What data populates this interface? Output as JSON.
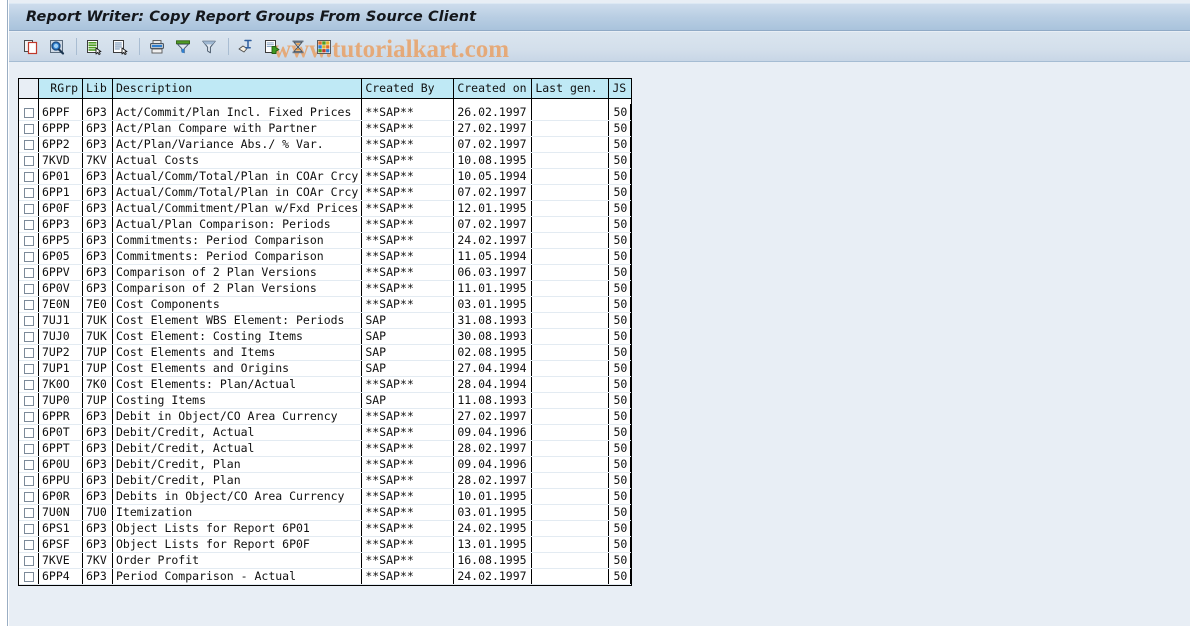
{
  "window": {
    "title": "Report Writer: Copy Report Groups From Source Client",
    "watermark": "www.tutorialkart.com"
  },
  "toolbar": {
    "items": [
      {
        "name": "copy-icon",
        "tooltip": "Copy"
      },
      {
        "name": "display-search-icon",
        "tooltip": "Display"
      },
      {
        "name": "separator",
        "tooltip": ""
      },
      {
        "name": "select-all-icon",
        "tooltip": "Select All"
      },
      {
        "name": "deselect-all-icon",
        "tooltip": "Deselect All"
      },
      {
        "name": "separator",
        "tooltip": ""
      },
      {
        "name": "print-icon",
        "tooltip": "Print"
      },
      {
        "name": "sort-filter-icon",
        "tooltip": "Sort"
      },
      {
        "name": "filter-icon",
        "tooltip": "Filter"
      },
      {
        "name": "separator",
        "tooltip": ""
      },
      {
        "name": "select-layout-icon",
        "tooltip": "Choose Layout"
      },
      {
        "name": "export-icon",
        "tooltip": "Export"
      },
      {
        "name": "hourglass-icon",
        "tooltip": "Wait"
      },
      {
        "name": "spreadsheet-icon",
        "tooltip": "Spreadsheet"
      }
    ]
  },
  "table": {
    "columns": [
      {
        "key": "rgrp",
        "label": "RGrp"
      },
      {
        "key": "lib",
        "label": "Lib"
      },
      {
        "key": "desc",
        "label": "Description"
      },
      {
        "key": "by",
        "label": "Created By"
      },
      {
        "key": "on",
        "label": "Created on"
      },
      {
        "key": "gen",
        "label": "Last gen."
      },
      {
        "key": "js",
        "label": "JS"
      }
    ],
    "rows": [
      {
        "rgrp": "6PPF",
        "lib": "6P3",
        "desc": "Act/Commit/Plan Incl. Fixed Prices",
        "by": "**SAP**",
        "on": "26.02.1997",
        "gen": "",
        "js": "50"
      },
      {
        "rgrp": "6PPP",
        "lib": "6P3",
        "desc": "Act/Plan Compare with Partner",
        "by": "**SAP**",
        "on": "27.02.1997",
        "gen": "",
        "js": "50"
      },
      {
        "rgrp": "6PP2",
        "lib": "6P3",
        "desc": "Act/Plan/Variance Abs./ % Var.",
        "by": "**SAP**",
        "on": "07.02.1997",
        "gen": "",
        "js": "50"
      },
      {
        "rgrp": "7KVD",
        "lib": "7KV",
        "desc": "Actual Costs",
        "by": "**SAP**",
        "on": "10.08.1995",
        "gen": "",
        "js": "50"
      },
      {
        "rgrp": "6P01",
        "lib": "6P3",
        "desc": "Actual/Comm/Total/Plan in COAr Crcy",
        "by": "**SAP**",
        "on": "10.05.1994",
        "gen": "",
        "js": "50"
      },
      {
        "rgrp": "6PP1",
        "lib": "6P3",
        "desc": "Actual/Comm/Total/Plan in COAr Crcy",
        "by": "**SAP**",
        "on": "07.02.1997",
        "gen": "",
        "js": "50"
      },
      {
        "rgrp": "6P0F",
        "lib": "6P3",
        "desc": "Actual/Commitment/Plan w/Fxd Prices",
        "by": "**SAP**",
        "on": "12.01.1995",
        "gen": "",
        "js": "50"
      },
      {
        "rgrp": "6PP3",
        "lib": "6P3",
        "desc": "Actual/Plan Comparison: Periods",
        "by": "**SAP**",
        "on": "07.02.1997",
        "gen": "",
        "js": "50"
      },
      {
        "rgrp": "6PP5",
        "lib": "6P3",
        "desc": "Commitments: Period Comparison",
        "by": "**SAP**",
        "on": "24.02.1997",
        "gen": "",
        "js": "50"
      },
      {
        "rgrp": "6P05",
        "lib": "6P3",
        "desc": "Commitments: Period Comparison",
        "by": "**SAP**",
        "on": "11.05.1994",
        "gen": "",
        "js": "50"
      },
      {
        "rgrp": "6PPV",
        "lib": "6P3",
        "desc": "Comparison of 2 Plan Versions",
        "by": "**SAP**",
        "on": "06.03.1997",
        "gen": "",
        "js": "50"
      },
      {
        "rgrp": "6P0V",
        "lib": "6P3",
        "desc": "Comparison of 2 Plan Versions",
        "by": "**SAP**",
        "on": "11.01.1995",
        "gen": "",
        "js": "50"
      },
      {
        "rgrp": "7E0N",
        "lib": "7E0",
        "desc": "Cost Components",
        "by": "**SAP**",
        "on": "03.01.1995",
        "gen": "",
        "js": "50"
      },
      {
        "rgrp": "7UJ1",
        "lib": "7UK",
        "desc": "Cost Element WBS Element: Periods",
        "by": "SAP",
        "on": "31.08.1993",
        "gen": "",
        "js": "50"
      },
      {
        "rgrp": "7UJ0",
        "lib": "7UK",
        "desc": "Cost Element: Costing Items",
        "by": "SAP",
        "on": "30.08.1993",
        "gen": "",
        "js": "50"
      },
      {
        "rgrp": "7UP2",
        "lib": "7UP",
        "desc": "Cost Elements and Items",
        "by": "SAP",
        "on": "02.08.1995",
        "gen": "",
        "js": "50"
      },
      {
        "rgrp": "7UP1",
        "lib": "7UP",
        "desc": "Cost Elements and Origins",
        "by": "SAP",
        "on": "27.04.1994",
        "gen": "",
        "js": "50"
      },
      {
        "rgrp": "7K0O",
        "lib": "7K0",
        "desc": "Cost Elements: Plan/Actual",
        "by": "**SAP**",
        "on": "28.04.1994",
        "gen": "",
        "js": "50"
      },
      {
        "rgrp": "7UP0",
        "lib": "7UP",
        "desc": "Costing Items",
        "by": "SAP",
        "on": "11.08.1993",
        "gen": "",
        "js": "50"
      },
      {
        "rgrp": "6PPR",
        "lib": "6P3",
        "desc": "Debit in Object/CO Area Currency",
        "by": "**SAP**",
        "on": "27.02.1997",
        "gen": "",
        "js": "50"
      },
      {
        "rgrp": "6P0T",
        "lib": "6P3",
        "desc": "Debit/Credit, Actual",
        "by": "**SAP**",
        "on": "09.04.1996",
        "gen": "",
        "js": "50"
      },
      {
        "rgrp": "6PPT",
        "lib": "6P3",
        "desc": "Debit/Credit, Actual",
        "by": "**SAP**",
        "on": "28.02.1997",
        "gen": "",
        "js": "50"
      },
      {
        "rgrp": "6P0U",
        "lib": "6P3",
        "desc": "Debit/Credit, Plan",
        "by": "**SAP**",
        "on": "09.04.1996",
        "gen": "",
        "js": "50"
      },
      {
        "rgrp": "6PPU",
        "lib": "6P3",
        "desc": "Debit/Credit, Plan",
        "by": "**SAP**",
        "on": "28.02.1997",
        "gen": "",
        "js": "50"
      },
      {
        "rgrp": "6P0R",
        "lib": "6P3",
        "desc": "Debits in Object/CO Area Currency",
        "by": "**SAP**",
        "on": "10.01.1995",
        "gen": "",
        "js": "50"
      },
      {
        "rgrp": "7U0N",
        "lib": "7U0",
        "desc": "Itemization",
        "by": "**SAP**",
        "on": "03.01.1995",
        "gen": "",
        "js": "50"
      },
      {
        "rgrp": "6PS1",
        "lib": "6P3",
        "desc": "Object Lists for Report 6P01",
        "by": "**SAP**",
        "on": "24.02.1995",
        "gen": "",
        "js": "50"
      },
      {
        "rgrp": "6PSF",
        "lib": "6P3",
        "desc": "Object Lists for Report 6P0F",
        "by": "**SAP**",
        "on": "13.01.1995",
        "gen": "",
        "js": "50"
      },
      {
        "rgrp": "7KVE",
        "lib": "7KV",
        "desc": "Order Profit",
        "by": "**SAP**",
        "on": "16.08.1995",
        "gen": "",
        "js": "50"
      },
      {
        "rgrp": "6PP4",
        "lib": "6P3",
        "desc": "Period Comparison - Actual",
        "by": "**SAP**",
        "on": "24.02.1997",
        "gen": "",
        "js": "50"
      }
    ]
  },
  "colors": {
    "header_cell": "#bfe9f5",
    "title_bar": "#b9cee3",
    "watermark": "#e8a36a",
    "page_background": "#e8eef5"
  }
}
